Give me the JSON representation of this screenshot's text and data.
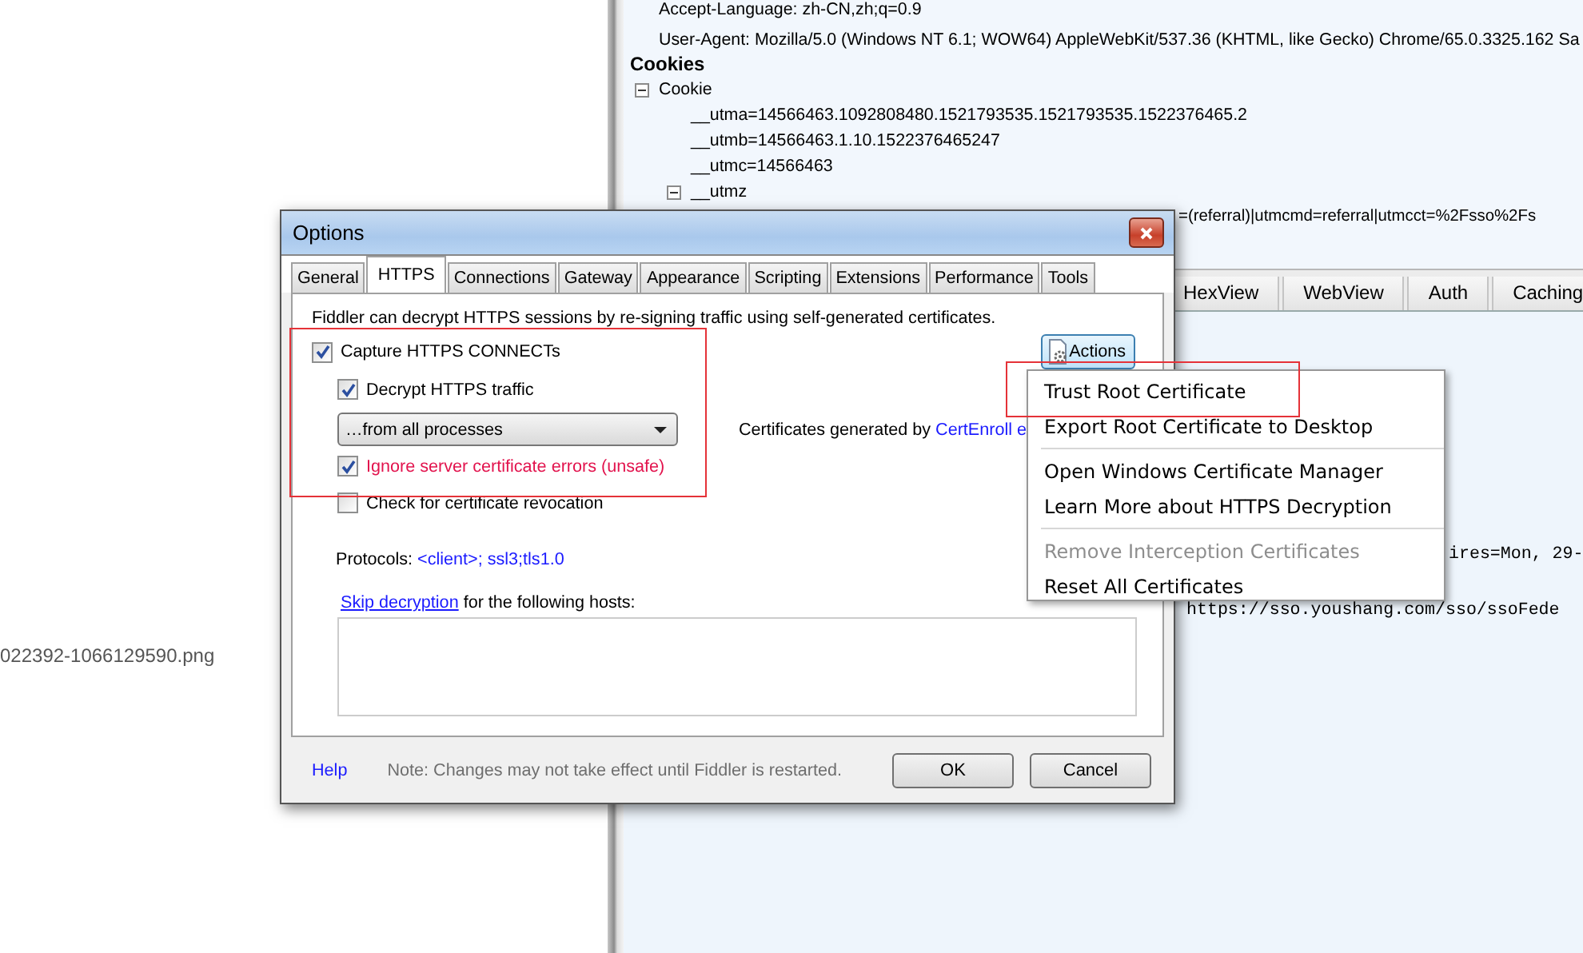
{
  "file_browser": {
    "file_name": "022392-1066129590.png"
  },
  "inspector": {
    "headers": [
      {
        "text": "Accept-Language: zh-CN,zh;q=0.9"
      },
      {
        "text": "User-Agent: Mozilla/5.0 (Windows NT 6.1; WOW64) AppleWebKit/537.36 (KHTML, like Gecko) Chrome/65.0.3325.162 Sa"
      }
    ],
    "cookies_title": "Cookies",
    "tree": [
      {
        "label": "Cookie",
        "expanded": true,
        "children": [
          {
            "label": "__utma=14566463.1092808480.1521793535.1521793535.1522376465.2"
          },
          {
            "label": "__utmb=14566463.1.10.1522376465247"
          },
          {
            "label": "__utmc=14566463"
          },
          {
            "label": "__utmz",
            "expanded": true,
            "children": [
              {
                "label": "=(referral)|utmcmd=referral|utmcct=%2Fsso%2Fs"
              }
            ]
          }
        ]
      }
    ],
    "tabs": [
      {
        "label": "HexView",
        "selected": false
      },
      {
        "label": "WebView",
        "selected": false
      },
      {
        "label": "Auth",
        "selected": false
      },
      {
        "label": "Caching",
        "selected": false
      }
    ],
    "response_lines": [
      "ires=Mon, 29-",
      "https://sso.youshang.com/sso/ssoFede"
    ]
  },
  "dialog": {
    "title": "Options",
    "tabs": [
      {
        "label": "General",
        "selected": false
      },
      {
        "label": "HTTPS",
        "selected": true
      },
      {
        "label": "Connections",
        "selected": false
      },
      {
        "label": "Gateway",
        "selected": false
      },
      {
        "label": "Appearance",
        "selected": false
      },
      {
        "label": "Scripting",
        "selected": false
      },
      {
        "label": "Extensions",
        "selected": false
      },
      {
        "label": "Performance",
        "selected": false
      },
      {
        "label": "Tools",
        "selected": false
      }
    ],
    "description": "Fiddler can decrypt HTTPS sessions by re-signing traffic using self-generated certificates.",
    "capture": {
      "label": "Capture HTTPS CONNECTs",
      "checked": true
    },
    "actions_button": "Actions",
    "decrypt": {
      "label": "Decrypt HTTPS traffic",
      "checked": true
    },
    "process_filter": {
      "value": "…from all processes"
    },
    "certificates_text": "Certificates generated by ",
    "certificates_link": "CertEnroll e",
    "ignore_errors": {
      "label": "Ignore server certificate errors (unsafe)",
      "checked": true,
      "color": "#e2134d"
    },
    "revocation": {
      "label": "Check for certificate revocation",
      "checked": false
    },
    "protocols_label": "Protocols: ",
    "protocols_link": "<client>; ssl3;tls1.0",
    "skip_link": "Skip decryption",
    "skip_text": " for the following hosts:",
    "help_link": "Help",
    "note": "Note: Changes may not take effect until Fiddler is restarted.",
    "ok_button": "OK",
    "cancel_button": "Cancel",
    "group_highlighted": true
  },
  "context_menu": {
    "items": [
      {
        "kind": "item",
        "label": "Trust Root Certificate",
        "disabled": false,
        "highlighted": true
      },
      {
        "kind": "item",
        "label": "Export Root Certificate to Desktop",
        "disabled": false,
        "highlighted": false
      },
      {
        "kind": "separator"
      },
      {
        "kind": "item",
        "label": "Open Windows Certificate Manager",
        "disabled": false,
        "highlighted": false
      },
      {
        "kind": "item",
        "label": "Learn More about HTTPS Decryption",
        "disabled": false,
        "highlighted": false
      },
      {
        "kind": "separator"
      },
      {
        "kind": "item",
        "label": "Remove Interception Certificates",
        "disabled": true,
        "highlighted": false
      },
      {
        "kind": "item",
        "label": "Reset All Certificates",
        "disabled": false,
        "highlighted": false
      }
    ]
  }
}
